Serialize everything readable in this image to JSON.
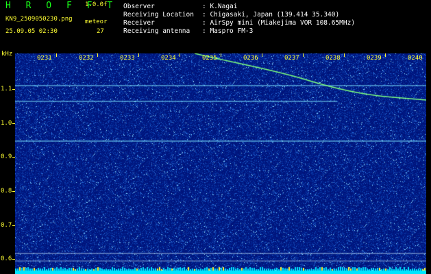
{
  "header": {
    "logo": "H R O F F T",
    "version": "1.0.0f",
    "filename": "KN9_2509050230.png",
    "meteor_label": "meteor",
    "meteor_count": "27",
    "timestamp": "25.09.05 02:30"
  },
  "info": [
    {
      "key": "Observer",
      "value": ": K.Nagai"
    },
    {
      "key": "Receiving Location",
      "value": ": Chigasaki, Japan (139.414 35.340)"
    },
    {
      "key": "Receiver",
      "value": ": AirSpy mini (Miakejima VOR 108.65MHz)"
    },
    {
      "key": "Receiving antenna",
      "value": ": Maspro FM-3"
    }
  ],
  "y_axis": {
    "unit": "kHz",
    "labels": [
      "1.1",
      "1.0",
      "0.9",
      "0.8",
      "0.7",
      "0.6"
    ]
  },
  "x_axis": {
    "labels": [
      "0231",
      "0232",
      "0233",
      "0234",
      "0235",
      "0236",
      "0237",
      "0238",
      "0239",
      "0240"
    ]
  },
  "colors": {
    "background": "#000000",
    "plot_bg": "#00147a",
    "label_yellow": "#ffff33",
    "logo_green": "#19ff19",
    "trace_green": "#7dff7d",
    "carrier_cyan": "#7fe8ff",
    "power_cyan": "#00e5ff"
  }
}
